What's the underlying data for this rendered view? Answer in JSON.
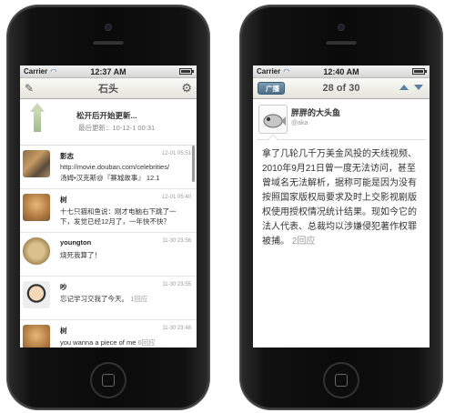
{
  "left_phone": {
    "status": {
      "carrier": "Carrier",
      "time": "12:37 AM"
    },
    "nav": {
      "title": "石头",
      "compose_icon": "compose-icon",
      "settings_icon": "gear-icon"
    },
    "pull": {
      "release_text": "松开后开始更新...",
      "last_updated": "最后更新：10-12-1 00:31"
    },
    "feed": [
      {
        "name": "影志",
        "date": "12-01 05:51",
        "line1": "http://movie.douban.com/celebrities/",
        "line2": "汤姆•汉克斯@『赛城故事』 12.1",
        "line1_is_link": true
      },
      {
        "name": "树",
        "date": "12-01 05:40",
        "line1": "十七只猫和鱼说：刚才电脑右下跳了一",
        "line2": "下，发觉已经12月了，一年快不快？"
      },
      {
        "name": "youngton",
        "date": "11-30 23:56",
        "line1": "烧死我算了！",
        "line2": ""
      },
      {
        "name": "吵",
        "date": "11-30 23:55",
        "line1": "忘记学习交我了今天。",
        "line2": "",
        "replies": "1回应"
      },
      {
        "name": "树",
        "date": "11-30 23:48",
        "line1": "you wanna a piece of me",
        "line2": "",
        "replies": "6回应"
      }
    ]
  },
  "right_phone": {
    "status": {
      "carrier": "Carrier",
      "time": "12:40 AM"
    },
    "nav": {
      "back": "广播",
      "title": "28 of 30",
      "up_icon": "up-arrow-icon",
      "down_icon": "down-arrow-icon"
    },
    "author": {
      "name": "胖胖的大头鱼",
      "handle": "@aka"
    },
    "post": {
      "text": "拿了几轮几千万美金风投的天线视频、2010年9月21日曾一度无法访问，甚至曾域名无法解析，据称可能是因为没有按照国家版权局要求及时上交影视剧版权使用授权情况统计结果。现如今它的法人代表、总裁均以涉嫌侵犯著作权罪被捕。",
      "replies": "2回应"
    }
  }
}
